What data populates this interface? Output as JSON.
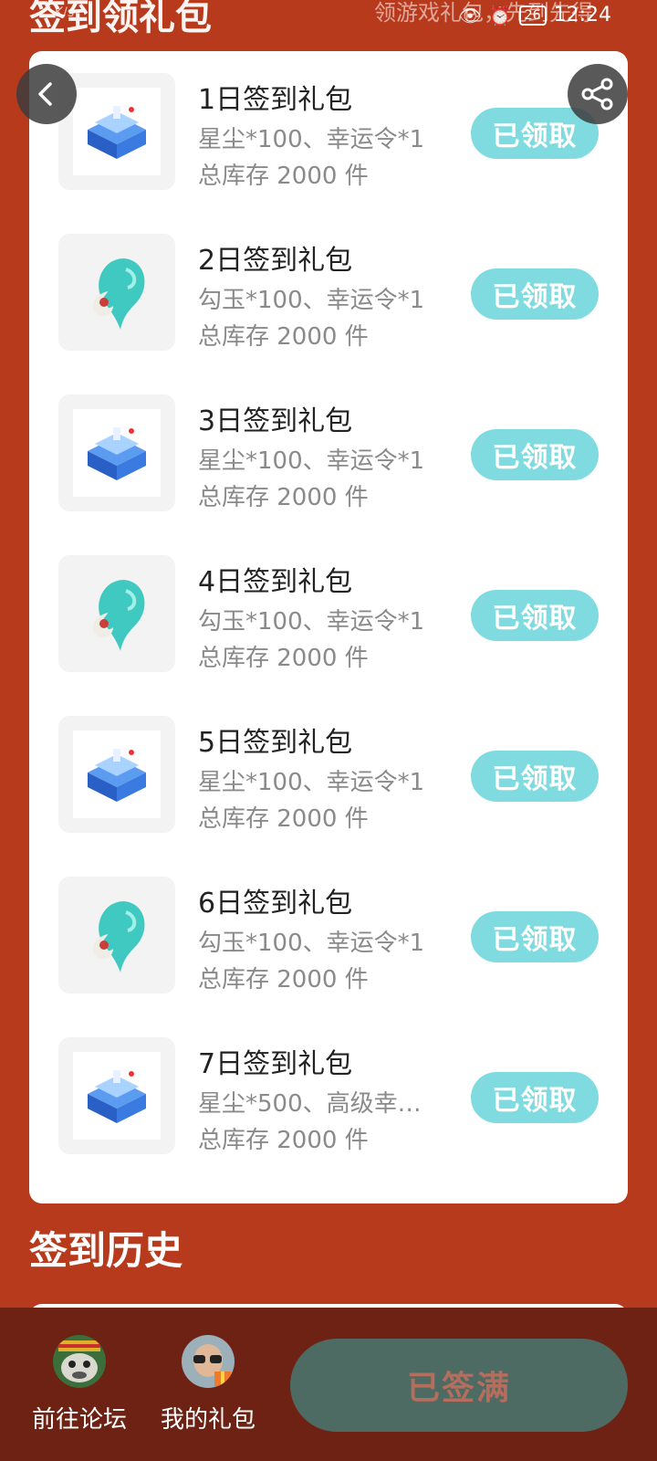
{
  "status_bar": {
    "speed": "K/s",
    "battery": "26",
    "time": "12:24"
  },
  "header": {
    "title": "签到领礼包",
    "subtitle": "领游戏礼包，先到先得"
  },
  "gifts": [
    {
      "title": "1日签到礼包",
      "content": "星尘*100、幸运令*1",
      "stock": "总库存 2000 件",
      "button": "已领取",
      "icon": "blue-chest-icon"
    },
    {
      "title": "2日签到礼包",
      "content": "勾玉*100、幸运令*1",
      "stock": "总库存 2000 件",
      "button": "已领取",
      "icon": "jade-magatama-icon"
    },
    {
      "title": "3日签到礼包",
      "content": "星尘*100、幸运令*1",
      "stock": "总库存 2000 件",
      "button": "已领取",
      "icon": "blue-chest-icon"
    },
    {
      "title": "4日签到礼包",
      "content": "勾玉*100、幸运令*1",
      "stock": "总库存 2000 件",
      "button": "已领取",
      "icon": "jade-magatama-icon"
    },
    {
      "title": "5日签到礼包",
      "content": "星尘*100、幸运令*1",
      "stock": "总库存 2000 件",
      "button": "已领取",
      "icon": "blue-chest-icon"
    },
    {
      "title": "6日签到礼包",
      "content": "勾玉*100、幸运令*1",
      "stock": "总库存 2000 件",
      "button": "已领取",
      "icon": "jade-magatama-icon"
    },
    {
      "title": "7日签到礼包",
      "content": "星尘*500、高级幸…",
      "stock": "总库存 2000 件",
      "button": "已领取",
      "icon": "blue-chest-icon"
    }
  ],
  "history": {
    "title": "签到历史"
  },
  "bottom_bar": {
    "forum_label": "前往论坛",
    "my_gift_label": "我的礼包",
    "signin_label": "已签满"
  },
  "colors": {
    "background": "#b83a1c",
    "claimed_button": "#7fdbe0",
    "signin_button": "#4d6a63",
    "bottom_bar": "#6e2214"
  }
}
